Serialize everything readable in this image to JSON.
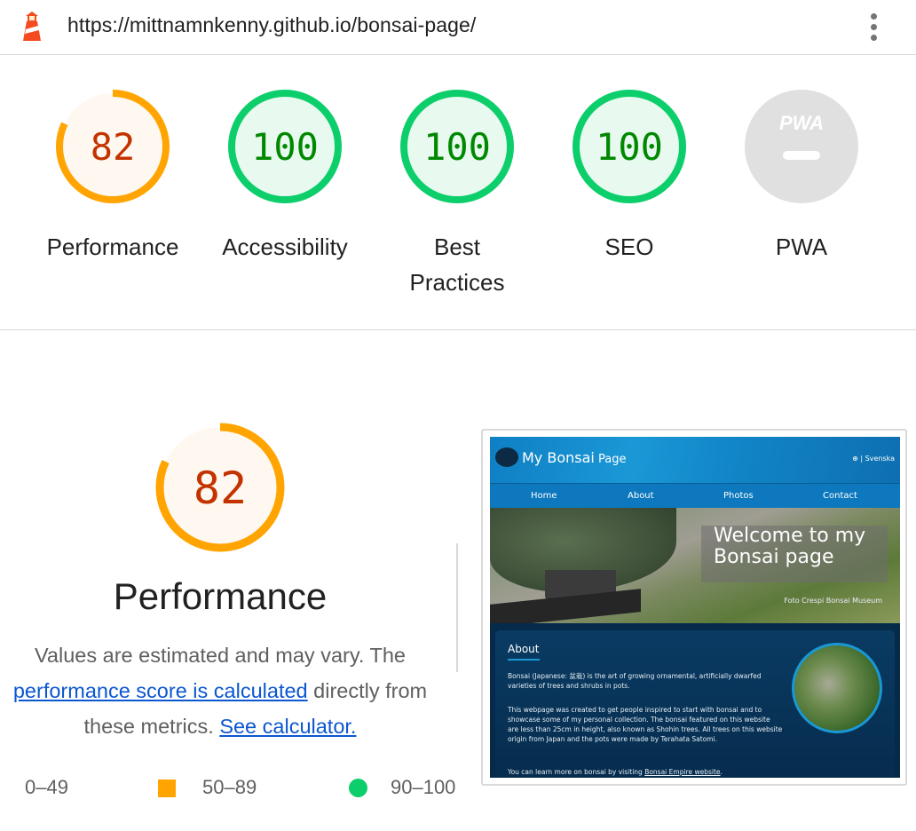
{
  "topbar": {
    "url": "https://mittnamnkenny.github.io/bonsai-page/",
    "logo_icon": "lighthouse-icon",
    "menu_icon": "more-vert-icon"
  },
  "colors": {
    "average_orange": "#ffa400",
    "average_text": "#c33300",
    "average_fill": "#fff8f0",
    "pass_green": "#0cce6b",
    "pass_text": "#008800",
    "pass_fill": "#e8faf0",
    "pwa_gray": "#e0e0e0"
  },
  "gauges": [
    {
      "label": "Performance",
      "score": "82",
      "value": 0.82,
      "status": "average"
    },
    {
      "label": "Accessibility",
      "score": "100",
      "value": 1.0,
      "status": "pass"
    },
    {
      "label": "Best Practices",
      "score": "100",
      "value": 1.0,
      "status": "pass"
    },
    {
      "label": "SEO",
      "score": "100",
      "value": 1.0,
      "status": "pass"
    },
    {
      "label": "PWA",
      "score": "",
      "badge": "PWA",
      "status": "pwa"
    }
  ],
  "performance": {
    "score": "82",
    "value": 0.82,
    "title": "Performance",
    "desc_1": "Values are estimated and may vary. The",
    "link_score": "performance score is calculated",
    "desc_2": " directly from",
    "desc_3": "these metrics. ",
    "link_calculator": "See calculator."
  },
  "legend": {
    "fail": "0–49",
    "average": "50–89",
    "pass": "90–100"
  },
  "screenshot": {
    "title": "My Bonsai",
    "title_small": " Page",
    "lang": "⊕ | Svenska",
    "nav": [
      "Home",
      "About",
      "Photos",
      "Contact"
    ],
    "hero_title": "Welcome to my Bonsai page",
    "hero_credit": "Foto Crespi Bonsai Museum",
    "about_heading": "About",
    "about_p1": "Bonsai (Japanese: 盆栽) is the art of growing ornamental, artificially dwarfed varieties of trees and shrubs in pots.",
    "about_p2": "This webpage was created to get people inspired to start with bonsai and to showcase some of my personal collection. The bonsai featured on this website are less than 25cm in height, also known as Shohin trees. All trees on this website origin from Japan and the pots were made by Terahata Satomi.",
    "about_p3_pre": "You can learn more on bonsai by visiting ",
    "about_p3_link": "Bonsai Empire website",
    "about_p3_post": "."
  }
}
